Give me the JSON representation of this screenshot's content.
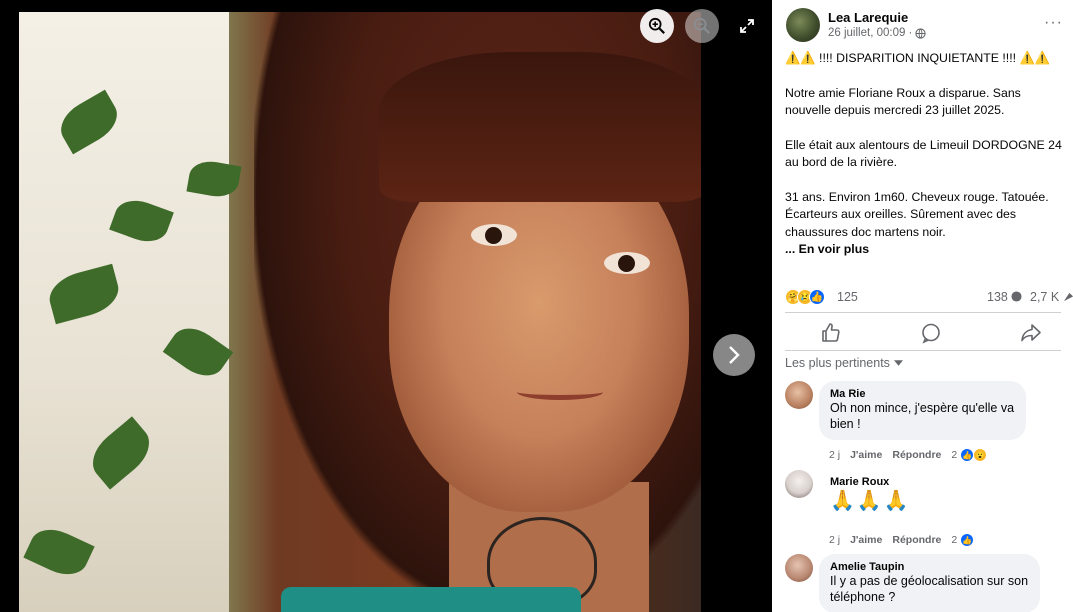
{
  "post": {
    "author": "Lea Larequie",
    "date": "26 juillet, 00:09 ·",
    "privacy_icon": "globe-icon",
    "more_label": "···",
    "lines": [
      "⚠️⚠️ !!!! DISPARITION INQUIETANTE !!!! ⚠️⚠️",
      "",
      "Notre amie Floriane Roux a disparue. Sans",
      "nouvelle depuis mercredi 23 juillet 2025.",
      "",
      "Elle était aux alentours de Limeuil DORDOGNE 24",
      "au bord de la rivière.",
      "",
      "31 ans. Environ 1m60. Cheveux rouge. Tatouée.",
      "Écarteurs aux oreilles. Sûrement avec des",
      "chaussures doc martens noir."
    ],
    "see_more": "... En voir plus"
  },
  "stats": {
    "reactions": "125",
    "comments": "138",
    "shares": "2,7 K"
  },
  "sort": {
    "label": "Les plus pertinents"
  },
  "comments": [
    {
      "name": "Ma Rie",
      "lines": [
        "Oh non mince, j'espère qu'elle va",
        "bien !"
      ],
      "age": "2 j",
      "like": "J'aime",
      "reply": "Répondre",
      "react_count": "2"
    },
    {
      "name": "Marie Roux",
      "lines": [
        "🙏🙏🙏"
      ],
      "age": "2 j",
      "like": "J'aime",
      "reply": "Répondre",
      "react_count": "2"
    },
    {
      "name": "Amelie Taupin",
      "lines": [
        "Il y a pas de géolocalisation sur son",
        "téléphone ?"
      ]
    }
  ],
  "colors": {
    "link_blue": "#0866ff",
    "muted": "#65676b",
    "bubble": "#f0f2f5"
  }
}
